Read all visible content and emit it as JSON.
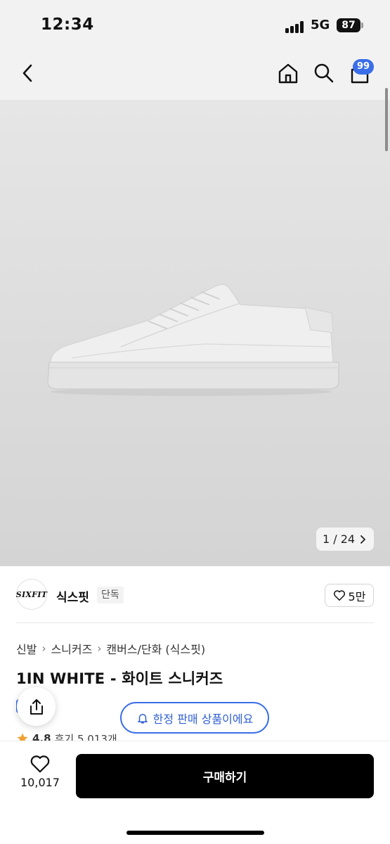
{
  "status_bar": {
    "time": "12:34",
    "network": "5G",
    "battery": "87"
  },
  "nav": {
    "cart_badge": "99"
  },
  "gallery": {
    "counter": "1 / 24"
  },
  "brand": {
    "logo_text": "SIXFIT",
    "name": "식스핏",
    "tag": "단독",
    "likes": "5만"
  },
  "breadcrumb": [
    "신발",
    "스니커즈",
    "캔버스/단화 (식스핏)"
  ],
  "product": {
    "title": "1IN WHITE - 화이트 스니커즈"
  },
  "notice": {
    "limited": "한정 판매 상품이에요"
  },
  "rating": {
    "score": "4.8",
    "reviews": "후기 5,013개"
  },
  "bottom": {
    "wish_count": "10,017",
    "buy_label": "구매하기"
  },
  "colors": {
    "accent_blue": "#3a6ee8",
    "buy_button": "#000000",
    "star": "#f0a030"
  }
}
